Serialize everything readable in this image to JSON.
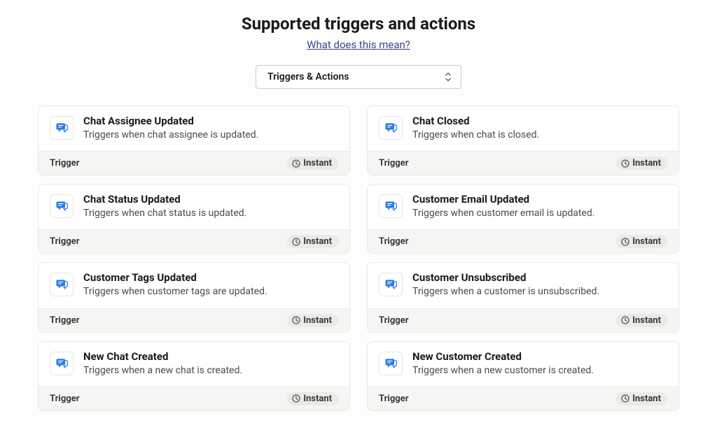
{
  "header": {
    "title": "Supported triggers and actions",
    "help_link": "What does this mean?"
  },
  "dropdown": {
    "label": "Triggers & Actions"
  },
  "icon_name": "chat-app-icon",
  "footer_labels": {
    "type": "Trigger",
    "badge": "Instant"
  },
  "cards": [
    {
      "title": "Chat Assignee Updated",
      "desc": "Triggers when chat assignee is updated."
    },
    {
      "title": "Chat Closed",
      "desc": "Triggers when chat is closed."
    },
    {
      "title": "Chat Status Updated",
      "desc": "Triggers when chat status is updated."
    },
    {
      "title": "Customer Email Updated",
      "desc": "Triggers when customer email is updated."
    },
    {
      "title": "Customer Tags Updated",
      "desc": "Triggers when customer tags are updated."
    },
    {
      "title": "Customer Unsubscribed",
      "desc": "Triggers when a customer is unsubscribed."
    },
    {
      "title": "New Chat Created",
      "desc": "Triggers when a new chat is created."
    },
    {
      "title": "New Customer Created",
      "desc": "Triggers when a new customer is created."
    }
  ]
}
